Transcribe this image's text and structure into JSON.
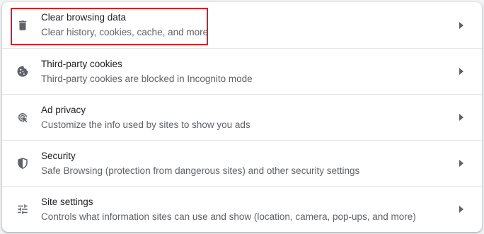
{
  "settings_list": {
    "items": [
      {
        "icon": "trash-icon",
        "title": "Clear browsing data",
        "subtitle": "Clear history, cookies, cache, and more"
      },
      {
        "icon": "cookie-icon",
        "title": "Third-party cookies",
        "subtitle": "Third-party cookies are blocked in Incognito mode"
      },
      {
        "icon": "ad-privacy-icon",
        "title": "Ad privacy",
        "subtitle": "Customize the info used by sites to show you ads"
      },
      {
        "icon": "shield-icon",
        "title": "Security",
        "subtitle": "Safe Browsing (protection from dangerous sites) and other security settings"
      },
      {
        "icon": "tune-icon",
        "title": "Site settings",
        "subtitle": "Controls what information sites can use and show (location, camera, pop-ups, and more)"
      }
    ]
  },
  "colors": {
    "highlight_border": "#e81123",
    "icon": "#5f6368",
    "title_text": "#202124",
    "subtitle_text": "#5f6368"
  }
}
